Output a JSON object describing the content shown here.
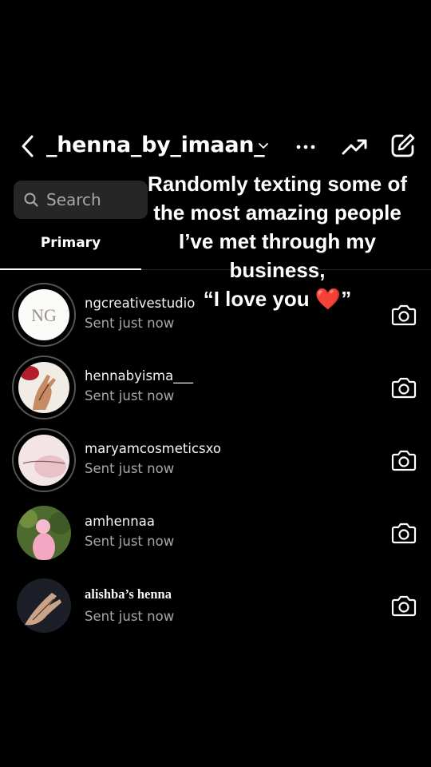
{
  "header": {
    "username": "_henna_by_imaan_",
    "back_icon": "chevron-left-icon",
    "dropdown_icon": "chevron-down-icon",
    "more_icon": "more-horizontal-icon",
    "trend_icon": "trending-up-icon",
    "compose_icon": "edit-icon"
  },
  "search": {
    "placeholder": "Search",
    "icon": "search-icon"
  },
  "tabs": {
    "primary_label": "Primary"
  },
  "overlay_caption": {
    "line1": "Randomly texting some of",
    "line2": "the most amazing people",
    "line3": "I’ve met through my",
    "line4": "business,",
    "line5": "“I love you ❤️”"
  },
  "threads": [
    {
      "name": "ngcreativestudio",
      "status": "Sent just now",
      "action_icon": "camera-icon"
    },
    {
      "name": "hennabyisma___",
      "status": "Sent just now",
      "action_icon": "camera-icon"
    },
    {
      "name": "maryamcosmeticsxo",
      "status": "Sent just now",
      "action_icon": "camera-icon"
    },
    {
      "name": "amhennaa",
      "status": "Sent just now",
      "action_icon": "camera-icon"
    },
    {
      "name": "alishba’s henna",
      "status": "Sent just now",
      "action_icon": "camera-icon"
    }
  ],
  "avatar_logos": {
    "ng": "NG"
  },
  "colors": {
    "background": "#000000",
    "secondary_text": "#a8a8a8",
    "search_bg": "#262626",
    "heart": "#e0243a"
  }
}
